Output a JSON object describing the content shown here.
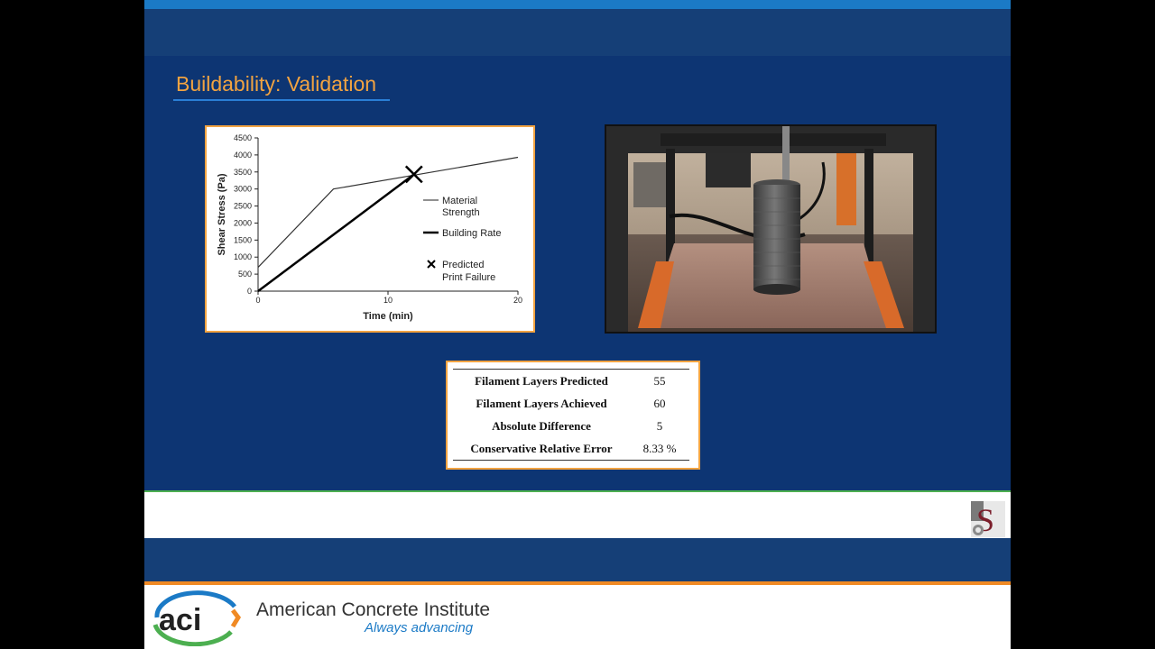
{
  "slide": {
    "title": "Buildability: Validation"
  },
  "chart_data": {
    "type": "line",
    "xlabel": "Time (min)",
    "ylabel": "Shear Stress (Pa)",
    "xlim": [
      0,
      20
    ],
    "ylim": [
      0,
      4500
    ],
    "x_ticks": [
      "0",
      "10",
      "20"
    ],
    "y_ticks": [
      "0",
      "500",
      "1000",
      "1500",
      "2000",
      "2500",
      "3000",
      "3500",
      "4000",
      "4500"
    ],
    "grid": false,
    "legend_position": "right",
    "series": [
      {
        "name": "Material Strength",
        "style": "thin",
        "x": [
          0,
          5.8,
          20
        ],
        "y": [
          700,
          3000,
          3930
        ]
      },
      {
        "name": "Building Rate",
        "style": "thick",
        "x": [
          0,
          12
        ],
        "y": [
          0,
          3430
        ]
      }
    ],
    "markers": [
      {
        "name": "Predicted Print Failure",
        "symbol": "x",
        "x": 12,
        "y": 3430
      }
    ],
    "legend": {
      "material_line1": "Material",
      "material_line2": "Strength",
      "building": "Building Rate",
      "failure_line1": "Predicted",
      "failure_line2": "Print Failure"
    }
  },
  "results_table": [
    {
      "label": "Filament Layers Predicted",
      "value": "55"
    },
    {
      "label": "Filament Layers Achieved",
      "value": "60"
    },
    {
      "label": "Absolute Difference",
      "value": "5"
    },
    {
      "label": "Conservative Relative Error",
      "value": "8.33 %"
    }
  ],
  "footer": {
    "logo_text": "aci",
    "org_name": "American Concrete Institute",
    "tagline": "Always advancing"
  },
  "colors": {
    "slide_blue": "#0d3573",
    "band_blue": "#153f77",
    "accent_orange": "#f2a341",
    "aci_blue": "#1b7ac6"
  }
}
